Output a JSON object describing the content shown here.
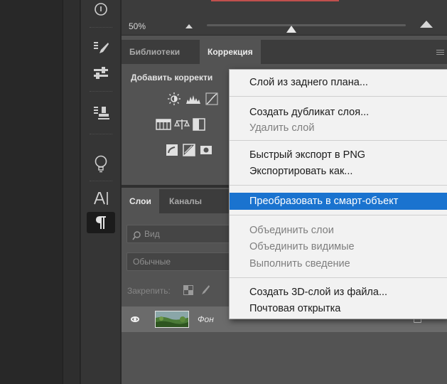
{
  "zoom": {
    "value": "50%"
  },
  "top_tabs": [
    {
      "label": "Библиотеки"
    },
    {
      "label": "Коррекция"
    }
  ],
  "adjustments": {
    "title": "Добавить корректи"
  },
  "layer_tabs": [
    {
      "label": "Слои"
    },
    {
      "label": "Каналы"
    }
  ],
  "layers_panel": {
    "search_placeholder": "Вид",
    "blend_mode": "Обычные",
    "lock_label": "Закрепить:"
  },
  "layers": [
    {
      "name": "Фон"
    }
  ],
  "context_menu": {
    "items": [
      {
        "label": "Слой из заднего плана..."
      },
      {
        "label": "Создать дубликат слоя..."
      },
      {
        "label": "Удалить слой"
      },
      {
        "label": "Быстрый экспорт в PNG"
      },
      {
        "label": "Экспортировать как..."
      },
      {
        "label": "Преобразовать в смарт-объект"
      },
      {
        "label": "Объединить слои"
      },
      {
        "label": "Объединить видимые"
      },
      {
        "label": "Выполнить сведение"
      },
      {
        "label": "Создать 3D-слой из файла..."
      },
      {
        "label": "Почтовая открытка"
      }
    ]
  },
  "colors": {
    "highlight": "#1a73cf",
    "panel": "#535353",
    "toolbar": "#353535"
  },
  "icons": [
    "info-icon",
    "brush-presets-icon",
    "properties-sliders-icon",
    "clone-stamp-icon",
    "lightbulb-icon",
    "character-icon",
    "paragraph-icon",
    "search-icon",
    "eye-icon",
    "lock-icon"
  ]
}
